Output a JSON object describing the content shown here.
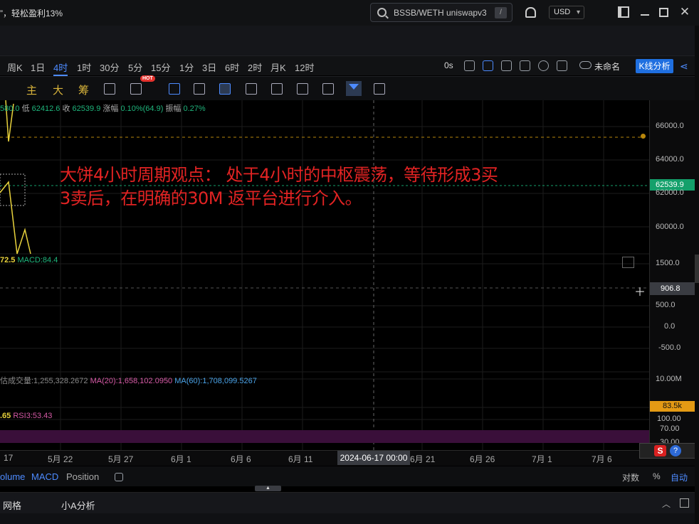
{
  "topbar": {
    "promo": "”，轻松盈利13%",
    "search_placeholder": "BSSB/WETH uniswapv3",
    "search_shortcut": "/",
    "currency": "USD"
  },
  "timeframes": [
    "周K",
    "1日",
    "4时",
    "1时",
    "30分",
    "5分",
    "15分",
    "1分",
    "3日",
    "6时",
    "2时",
    "月K",
    "12时"
  ],
  "active_timeframe": "4时",
  "toolbar_right": {
    "countdown": "0s",
    "layout_name": "未命名",
    "kline_button": "K线分析"
  },
  "drawing_tools": {
    "main": "主",
    "big": "大",
    "chips": "筹",
    "hot_badge": "HOT"
  },
  "ohlc": {
    "open_partial": "580.0",
    "low_label": "低",
    "low": "62412.6",
    "close_label": "收",
    "close": "62539.9",
    "change_label": "涨幅",
    "change": "0.10%(64.9)",
    "amp_label": "振幅",
    "amp": "0.27%"
  },
  "macd_row": {
    "partial": "72.5",
    "macd": "MACD:84.4"
  },
  "volume_row": {
    "vol": "估成交量:1,255,328.2672",
    "ma20": "MA(20):1,658,102.0950",
    "ma60": "MA(60):1,708,099.5267"
  },
  "rsi_row": {
    "partial": ".65",
    "rsi3": "RSI3:53.43"
  },
  "annotation": {
    "line1": "大饼4小时周期观点： 处于4小时的中枢震荡，等待形成3买",
    "line2": "3卖后，在明确的30M 返平台进行介入。"
  },
  "price_axis": {
    "labels": [
      "66000.0",
      "64000.0",
      "62000.0",
      "60000.0"
    ],
    "current_price": "62539.9",
    "macd_labels": [
      "1500.0",
      "500.0",
      "0.0",
      "-500.0"
    ],
    "crosshair_value": "906.8",
    "vol_labels": [
      "10.00M"
    ],
    "vol_current": "83.5k",
    "rsi_labels": [
      "100.00",
      "70.00",
      "30.00"
    ]
  },
  "date_axis": {
    "labels": [
      "17",
      "5月 22",
      "5月 27",
      "6月 1",
      "6月 6",
      "6月 11",
      "6月 21",
      "6月 26",
      "7月 1",
      "7月 6"
    ],
    "crosshair_date": "2024-06-17 00:00"
  },
  "indicator_tabs": [
    "olume",
    "MACD",
    "Position"
  ],
  "scale_options": [
    "对数",
    "%",
    "自动"
  ],
  "footer": {
    "grid": "网格",
    "ai": "小A分析"
  },
  "helper": {
    "s": "S",
    "q": "?"
  },
  "colors": {
    "up": "#14a06b",
    "accent": "#4d8bff",
    "annotation": "#e22323",
    "volume_tag": "#e49a14",
    "rsi_band": "#3a0f3a"
  }
}
